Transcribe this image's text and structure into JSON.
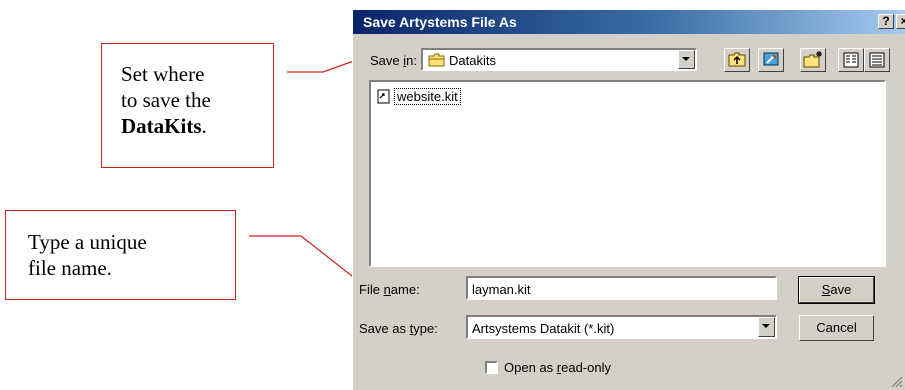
{
  "callouts": {
    "save_location": {
      "line1": "Set where",
      "line2": "to save the",
      "bold": "DataKits",
      "suffix": "."
    },
    "file_name": {
      "line1": "Type a unique",
      "line2": "file name."
    }
  },
  "dialog": {
    "title": "Save Artystems File As",
    "help_button": "?",
    "close_button": "×",
    "save_in": {
      "label_pre": "Save ",
      "label_accel": "i",
      "label_post": "n:",
      "value": "Datakits"
    },
    "files": [
      {
        "name": "website.kit",
        "icon": "file-shortcut-icon"
      }
    ],
    "file_name": {
      "label_pre": "File ",
      "label_accel": "n",
      "label_post": "ame:",
      "value": "layman.kit"
    },
    "save_as_type": {
      "label_pre": "Save as ",
      "label_accel": "t",
      "label_post": "ype:",
      "value": "Artsystems Datakit (*.kit)"
    },
    "save_button": {
      "accel": "S",
      "rest": "ave"
    },
    "cancel_button": "Cancel",
    "readonly": {
      "pre": "Open as ",
      "accel": "r",
      "post": "ead-only"
    }
  },
  "colors": {
    "callout_border": "#d0221b",
    "title_bar": "#0a246a",
    "dialog_bg": "#d4d0c8"
  }
}
